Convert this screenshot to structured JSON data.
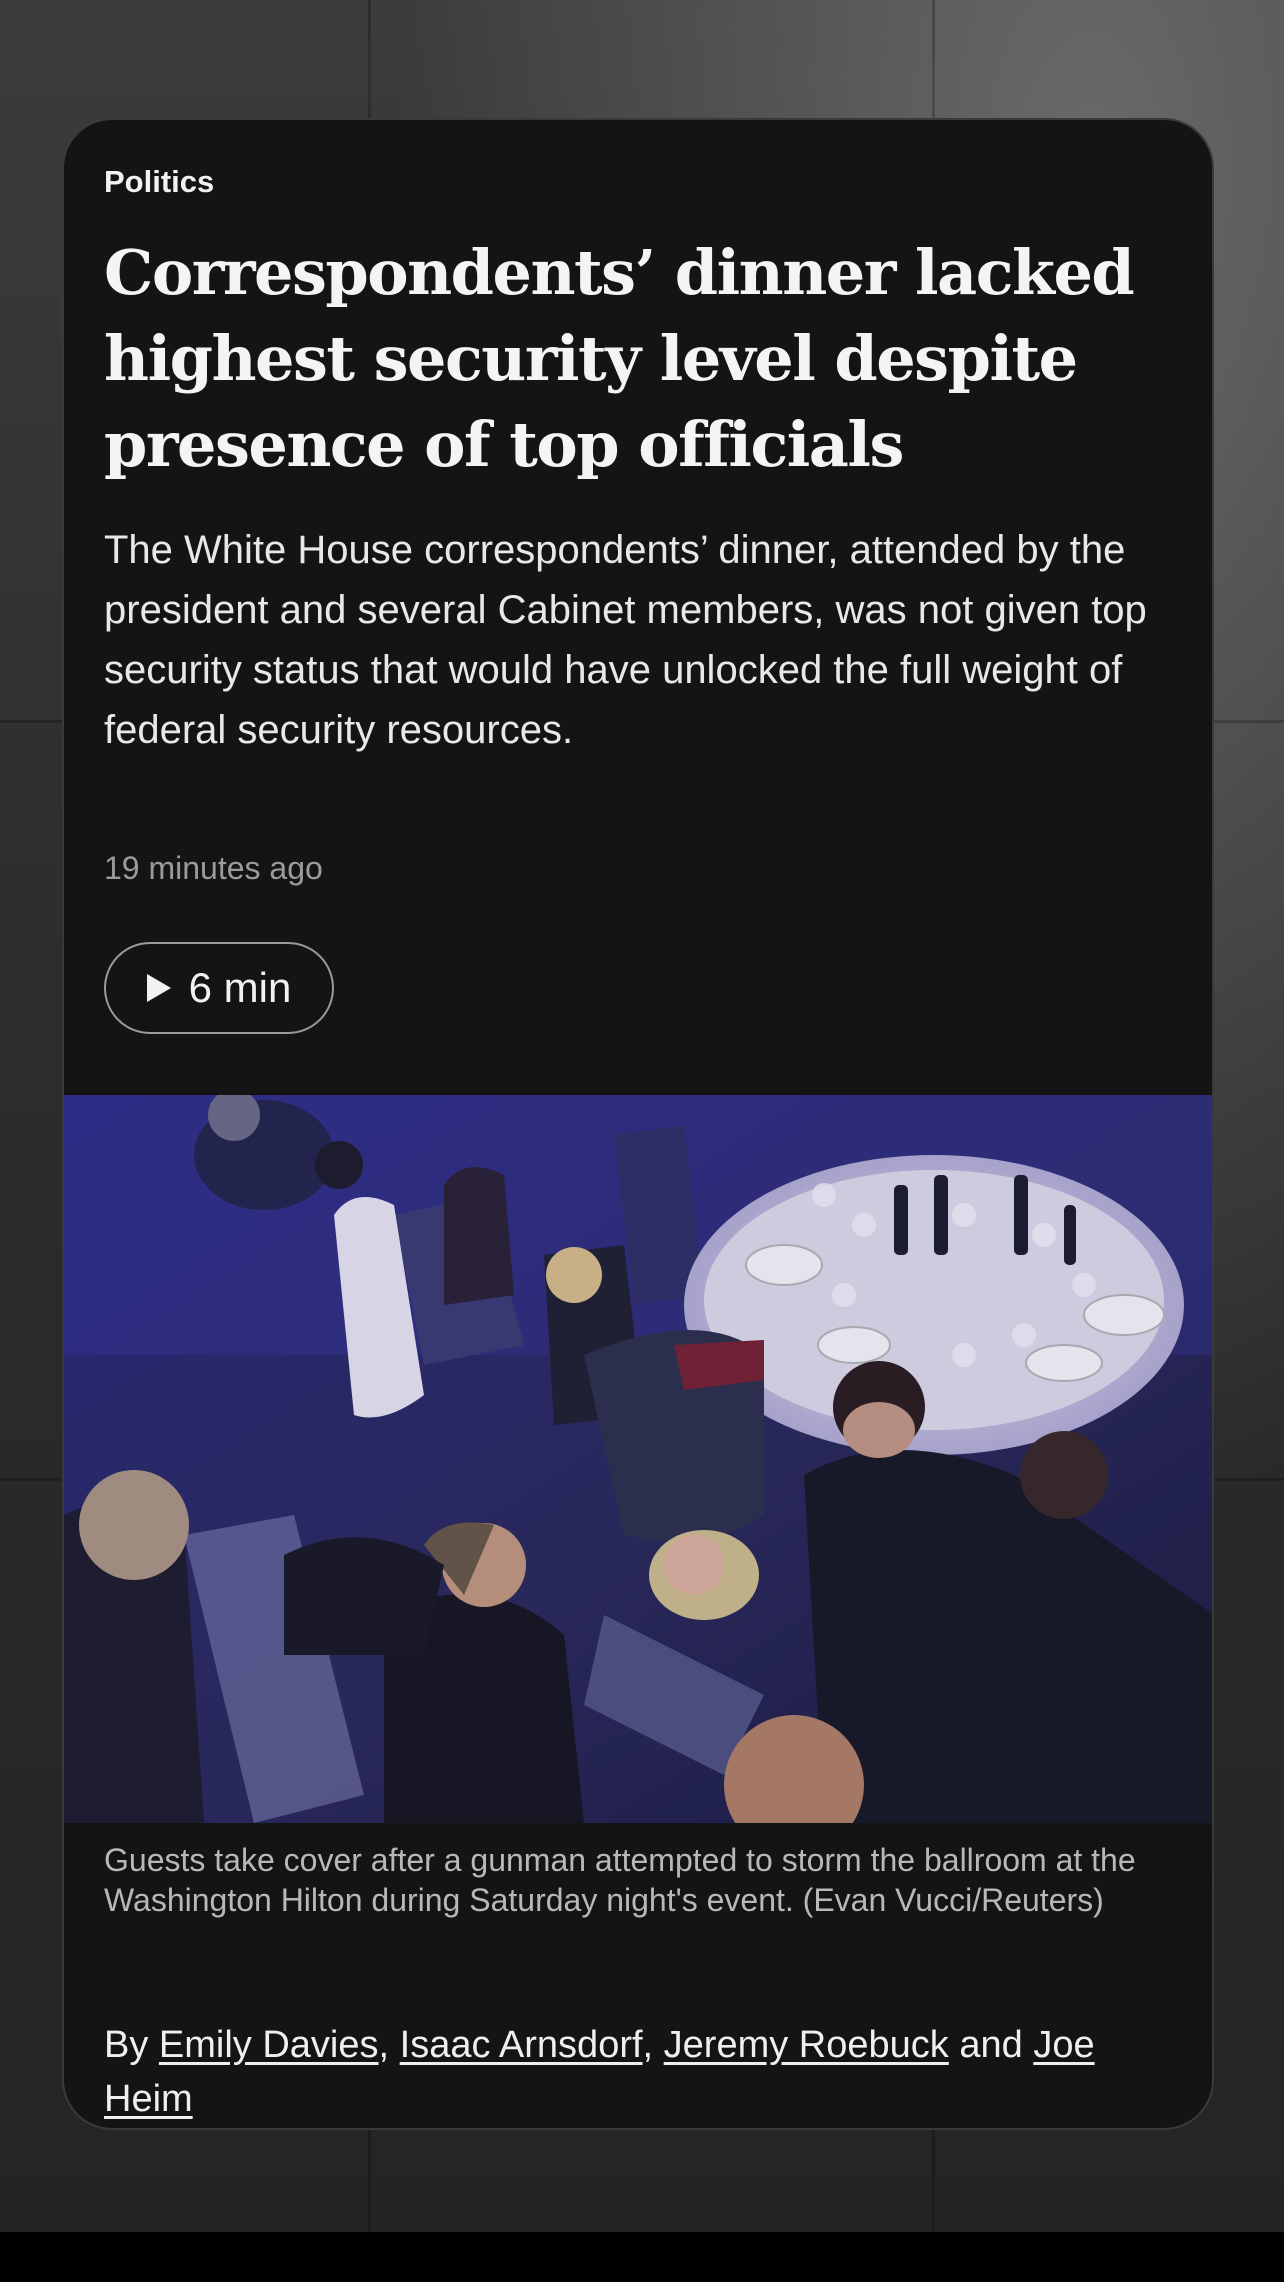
{
  "article": {
    "section": "Politics",
    "headline": "Correspondents’ dinner lacked highest security level despite presence of top officials",
    "dek": "The White House correspondents’ dinner, attended by the president and several Cabinet members, was not given top security status that would have unlocked the full weight of federal security resources.",
    "timestamp": "19 minutes ago",
    "listen_label": "6 min",
    "listen_icon": "play-icon",
    "photo_caption": "Guests take cover after a gunman attempted to storm the ballroom at the Washington Hilton during Saturday night's event. (Evan Vucci/Reuters)",
    "byline": {
      "prefix": "By ",
      "authors": [
        "Emily Davies",
        "Isaac Arnsdorf",
        "Jeremy Roebuck",
        "Joe Heim"
      ],
      "sep1": ", ",
      "sep2": ", ",
      "sep3": " and "
    }
  },
  "colors": {
    "card_background": "#141414",
    "text_primary": "#f4f4f4",
    "text_muted": "#9b9b9b"
  }
}
